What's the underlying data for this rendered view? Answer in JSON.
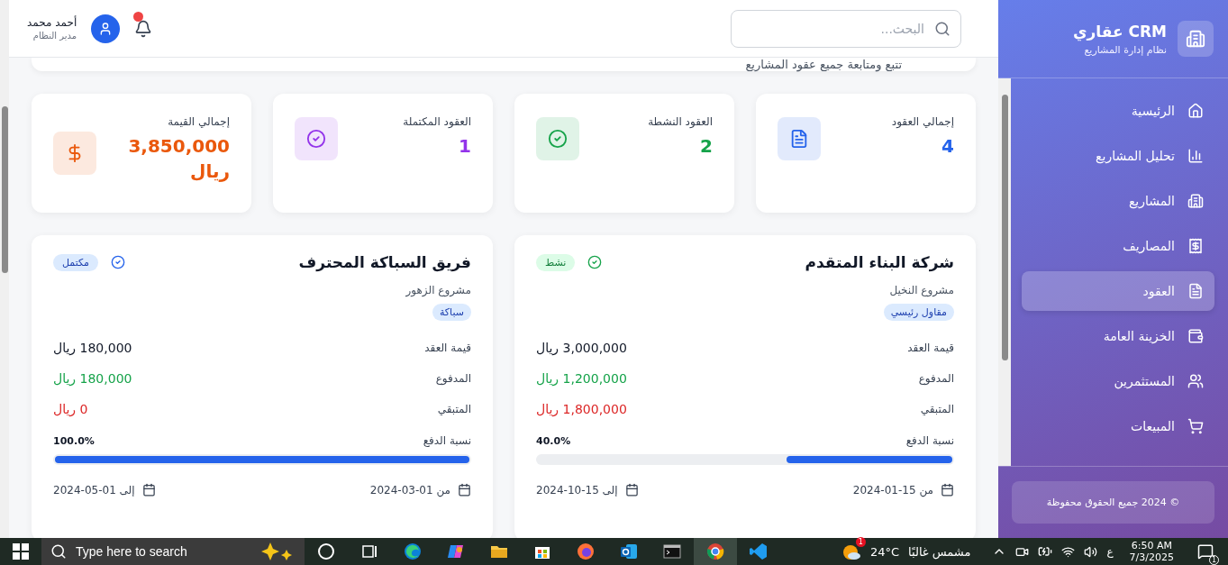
{
  "sidebar": {
    "brand": "CRM عقاري",
    "subtitle": "نظام إدارة المشاريع",
    "items": [
      {
        "label": "الرئيسية",
        "kind": "home",
        "selected": false
      },
      {
        "label": "تحليل المشاريع",
        "kind": "chart",
        "selected": false
      },
      {
        "label": "المشاريع",
        "kind": "building",
        "selected": false
      },
      {
        "label": "المصاريف",
        "kind": "receipt",
        "selected": false
      },
      {
        "label": "العقود",
        "kind": "document",
        "selected": true
      },
      {
        "label": "الخزينة العامة",
        "kind": "wallet",
        "selected": false
      },
      {
        "label": "المستثمرين",
        "kind": "users",
        "selected": false
      },
      {
        "label": "المبيعات",
        "kind": "cart",
        "selected": false
      }
    ],
    "footer": "© 2024 جميع الحقوق محفوظة"
  },
  "header": {
    "search": {
      "placeholder": "البحث..."
    },
    "notifications": {
      "unread": true
    },
    "user": {
      "name": "أحمد محمد",
      "role": "مدير النظام"
    }
  },
  "page_banner": {
    "subtitle": "تتبع ومتابعة جميع عقود المشاريع"
  },
  "stats": [
    {
      "label": "إجمالي العقود",
      "value": "4",
      "color": "#2563eb",
      "kind": "document"
    },
    {
      "label": "العقود النشطة",
      "value": "2",
      "color": "#16a34a",
      "kind": "check"
    },
    {
      "label": "العقود المكتملة",
      "value": "1",
      "color": "#9333ea",
      "kind": "check"
    },
    {
      "label": "إجمالي القيمة",
      "value": "3,850,000 ريال",
      "color": "#ea580c",
      "kind": "money"
    }
  ],
  "contracts": [
    {
      "name": "شركة البناء المتقدم",
      "status": {
        "label": "نشط",
        "kind": "active"
      },
      "project": "مشروع النخيل",
      "tag": "مقاول رئيسي",
      "rows": [
        {
          "label": "قيمة العقد",
          "value": "3,000,000 ريال",
          "kind": "total"
        },
        {
          "label": "المدفوع",
          "value": "1,200,000 ريال",
          "kind": "paid"
        },
        {
          "label": "المتبقي",
          "value": "1,800,000 ريال",
          "kind": "remaining"
        }
      ],
      "payment": {
        "label": "نسبة الدفع",
        "percent": "40.0%",
        "level": 0.4
      },
      "dates": [
        {
          "prefix": "من",
          "date": "15-01-2024"
        },
        {
          "prefix": "إلى",
          "date": "15-10-2024"
        }
      ]
    },
    {
      "name": "فريق السباكة المحترف",
      "status": {
        "label": "مكتمل",
        "kind": "completed"
      },
      "project": "مشروع الزهور",
      "tag": "سباكة",
      "rows": [
        {
          "label": "قيمة العقد",
          "value": "180,000 ريال",
          "kind": "total"
        },
        {
          "label": "المدفوع",
          "value": "180,000 ريال",
          "kind": "paid"
        },
        {
          "label": "المتبقي",
          "value": "0 ريال",
          "kind": "remaining"
        }
      ],
      "payment": {
        "label": "نسبة الدفع",
        "percent": "100.0%",
        "level": 1
      },
      "dates": [
        {
          "prefix": "من",
          "date": "01-03-2024"
        },
        {
          "prefix": "إلى",
          "date": "01-05-2024"
        }
      ]
    }
  ],
  "taskbar": {
    "search_placeholder": "Type here to search",
    "apps": [
      {
        "kind": "cortana"
      },
      {
        "kind": "taskview"
      },
      {
        "kind": "edge"
      },
      {
        "kind": "copilot"
      },
      {
        "kind": "files"
      },
      {
        "kind": "store"
      },
      {
        "kind": "firefox"
      },
      {
        "kind": "outlook"
      },
      {
        "kind": "terminal"
      },
      {
        "kind": "chrome",
        "selected": true
      },
      {
        "kind": "vscode"
      }
    ],
    "weather": {
      "temp": "24°C",
      "condition": "مشمس غالبًا",
      "alerts": "1"
    },
    "language": "ع",
    "time": "6:50 AM",
    "date": "7/3/2025",
    "notification_count": "1"
  }
}
